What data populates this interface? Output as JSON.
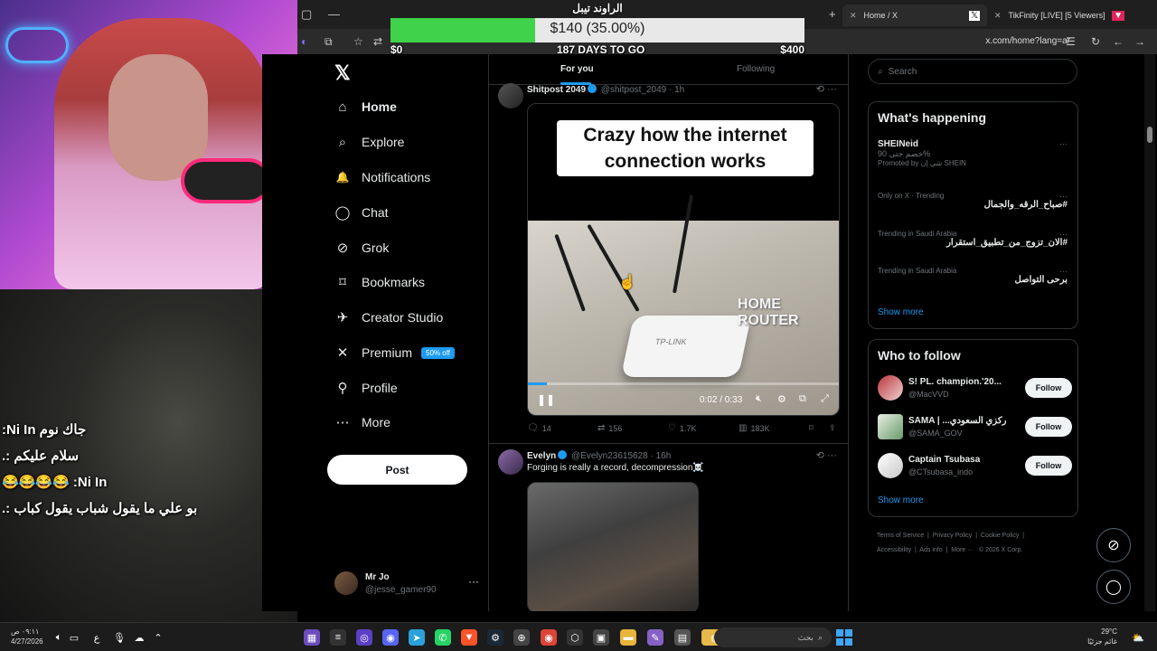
{
  "stream": {
    "chat": [
      "جاك نوم Ni In:",
      "سلام عليكم :.",
      "Ni In: 😂😂😂😂",
      "بو علي ما يقول شباب يقول كباب :."
    ],
    "donation": {
      "title": "الراوند تيبل",
      "amount": "$140 (35.00%)",
      "progress": 0.35,
      "min": "$0",
      "max": "$400",
      "days": "187 DAYS TO GO"
    }
  },
  "browser": {
    "tabs": [
      {
        "label": "Home / X",
        "icon": "x-logo-icon"
      },
      {
        "label": "TikFinity [LIVE] [5 Viewers]",
        "icon": "tikfinity-icon"
      }
    ],
    "url": "x.com/home?lang=ar"
  },
  "sidebar": {
    "logo": "𝕏",
    "items": [
      {
        "label": "Home",
        "icon": "home-icon",
        "glyph": "⌂",
        "active": true
      },
      {
        "label": "Explore",
        "icon": "search-icon",
        "glyph": "⌕"
      },
      {
        "label": "Notifications",
        "icon": "bell-icon",
        "glyph": "🔔"
      },
      {
        "label": "Chat",
        "icon": "chat-icon",
        "glyph": "◯"
      },
      {
        "label": "Grok",
        "icon": "grok-icon",
        "glyph": "⊘"
      },
      {
        "label": "Bookmarks",
        "icon": "bookmark-icon",
        "glyph": "⌑"
      },
      {
        "label": "Creator Studio",
        "icon": "rocket-icon",
        "glyph": "✈"
      },
      {
        "label": "Premium",
        "icon": "x-premium-icon",
        "glyph": "✕",
        "badge": "50% off"
      },
      {
        "label": "Profile",
        "icon": "person-icon",
        "glyph": "⚲"
      },
      {
        "label": "More",
        "icon": "more-circle-icon",
        "glyph": "⋯"
      }
    ],
    "post_label": "Post",
    "account": {
      "name": "Mr Jo",
      "handle": "@jesse_gamer90"
    }
  },
  "feed": {
    "tabs": [
      "For you",
      "Following"
    ],
    "tweet1": {
      "name": "Shitpost 2049",
      "handle": "@shitpost_2049 · 1h",
      "caption": "Crazy how the internet connection works",
      "overlay_label": "HOME ROUTER",
      "router_brand": "TP-LINK",
      "video_time": "0:02 / 0:33",
      "video_progress": 0.06,
      "replies": "14",
      "reposts": "156",
      "likes": "1.7K",
      "views": "183K"
    },
    "tweet2": {
      "name": "Evelyn",
      "handle": "@Evelyn23615628 · 16h",
      "text": "Forging is really a record, decompression☠️"
    }
  },
  "right": {
    "search_placeholder": "Search",
    "happening": {
      "title": "What's happening",
      "trends": [
        {
          "title": "SHEINeid",
          "sub": "خصم حتى 90%",
          "ctx": "Promoted by شي إن SHEIN"
        },
        {
          "ctx": "Only on X · Trending",
          "title": "#صباح_الرقه_والجمال"
        },
        {
          "ctx": "Trending in Saudi Arabia",
          "title": "#الان_تزوج_من_تطبيق_استقرار"
        },
        {
          "ctx": "Trending in Saudi Arabia",
          "title": "برحى التواصل"
        }
      ],
      "show_more": "Show more"
    },
    "who_to_follow": {
      "title": "Who to follow",
      "accounts": [
        {
          "name": "S! PL. champion.'20...",
          "handle": "@MacVVD",
          "follow": "Follow"
        },
        {
          "name": "SAMA | ...ركزي السعودي",
          "handle": "@SAMA_GOV",
          "follow": "Follow"
        },
        {
          "name": "Captain Tsubasa",
          "handle": "@CTsubasa_indo",
          "follow": "Follow"
        }
      ],
      "show_more": "Show more"
    },
    "footer": [
      "Terms of Service",
      "Privacy Policy",
      "Cookie Policy",
      "Accessibility",
      "Ads info",
      "More ···",
      "© 2026 X Corp."
    ]
  },
  "taskbar": {
    "time": "٠٩:١١ ص",
    "date": "4/27/2026",
    "search_placeholder": "بحث",
    "weather_temp": "29°C",
    "weather_desc": "غائم جزئيًا"
  },
  "colors": {
    "accent": "#1d9bf0",
    "progress_fill": "#3fd24a",
    "background": "#000000"
  }
}
